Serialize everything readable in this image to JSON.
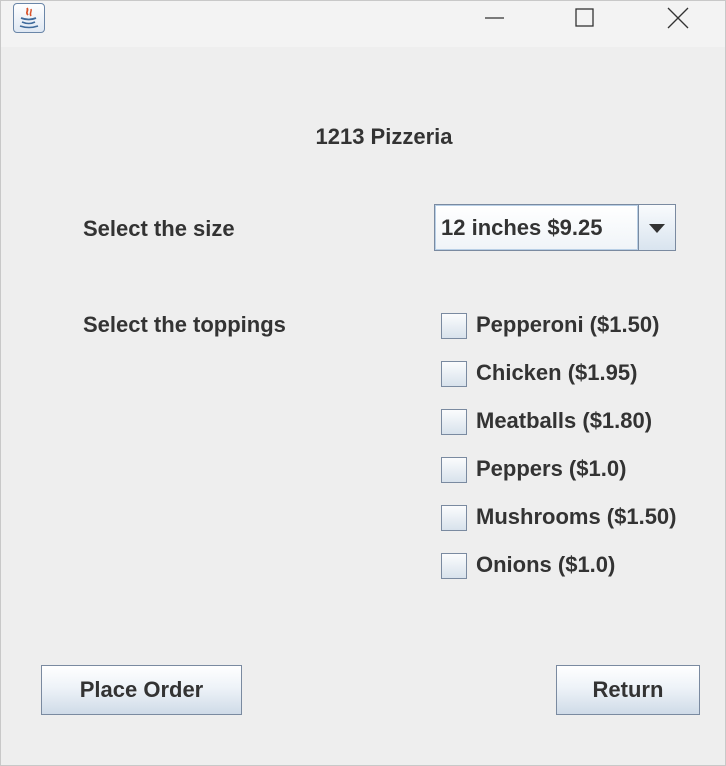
{
  "window": {
    "app_icon": "java-icon",
    "controls": [
      "minimize-icon",
      "maximize-icon",
      "close-icon"
    ]
  },
  "main": {
    "title": "1213 Pizzeria",
    "size_label": "Select the size",
    "size_selected": "12 inches $9.25",
    "toppings_label": "Select the toppings",
    "toppings": [
      {
        "label": "Pepperoni ($1.50)",
        "checked": false
      },
      {
        "label": "Chicken ($1.95)",
        "checked": false
      },
      {
        "label": "Meatballs ($1.80)",
        "checked": false
      },
      {
        "label": "Peppers ($1.0)",
        "checked": false
      },
      {
        "label": "Mushrooms ($1.50)",
        "checked": false
      },
      {
        "label": "Onions ($1.0)",
        "checked": false
      }
    ]
  },
  "buttons": {
    "place_order": "Place Order",
    "return": "Return"
  }
}
